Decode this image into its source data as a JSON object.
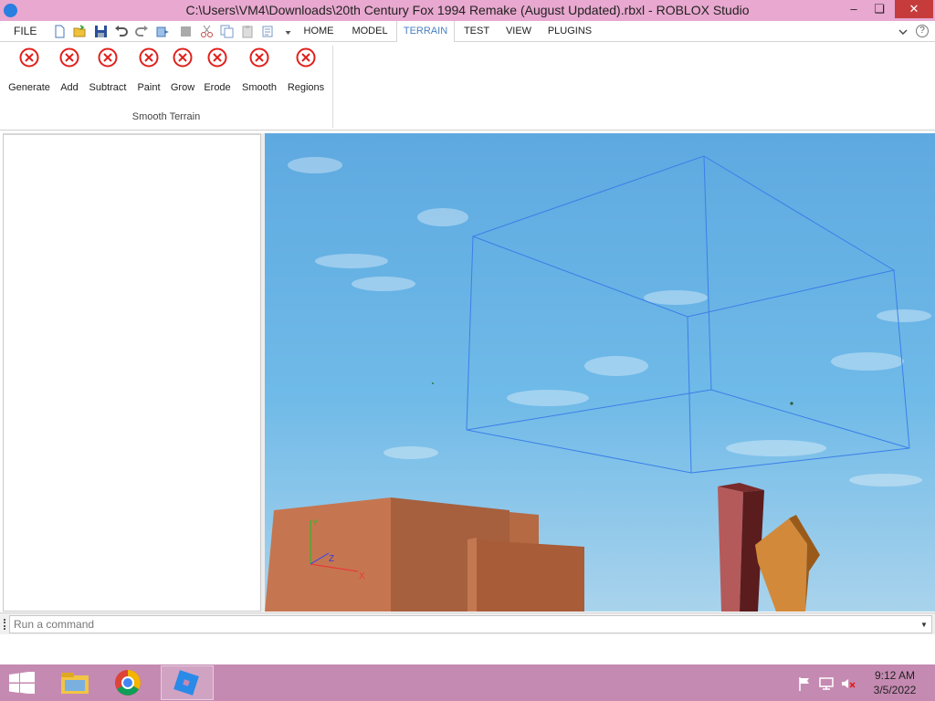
{
  "window": {
    "title": "C:\\Users\\VM4\\Downloads\\20th Century Fox 1994 Remake (August Updated).rbxl - ROBLOX Studio",
    "minimize": "–",
    "maximize": "❏",
    "close": "✕"
  },
  "menu": {
    "file": "FILE",
    "tabs": [
      {
        "label": "HOME"
      },
      {
        "label": "MODEL"
      },
      {
        "label": "TERRAIN",
        "active": true
      },
      {
        "label": "TEST"
      },
      {
        "label": "VIEW"
      },
      {
        "label": "PLUGINS"
      }
    ]
  },
  "ribbon": {
    "group_label": "Smooth Terrain",
    "tools": [
      {
        "label": "Generate",
        "icon": "error-icon"
      },
      {
        "label": "Add",
        "icon": "error-icon"
      },
      {
        "label": "Subtract",
        "icon": "error-icon"
      },
      {
        "label": "Paint",
        "icon": "error-icon"
      },
      {
        "label": "Grow",
        "icon": "error-icon"
      },
      {
        "label": "Erode",
        "icon": "error-icon"
      },
      {
        "label": "Smooth",
        "icon": "error-icon"
      },
      {
        "label": "Regions",
        "icon": "error-icon"
      }
    ]
  },
  "viewport": {
    "axis_labels": {
      "y": "Y",
      "z": "Z",
      "x": "X"
    }
  },
  "command_bar": {
    "placeholder": "Run a command"
  },
  "taskbar": {
    "time": "9:12 AM",
    "date": "3/5/2022"
  },
  "colors": {
    "titlebar": "#e8a8cf",
    "taskbar": "#c58ab2",
    "error_red": "#e0201c",
    "sky": "#5fb0e8",
    "selection_box": "#3a7fe8"
  }
}
